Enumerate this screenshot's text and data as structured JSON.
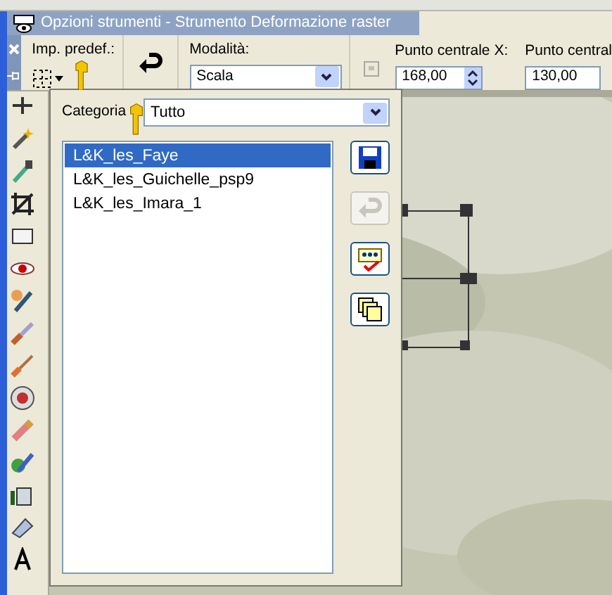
{
  "window": {
    "title": "Opzioni strumenti - Strumento Deformazione raster"
  },
  "toolbar": {
    "presets_label": "Imp. predef.:",
    "mode_label": "Modalità:",
    "mode_value": "Scala",
    "center_x_label": "Punto centrale X:",
    "center_x_value": "168,00",
    "center_y_label": "Punto central",
    "center_y_value": "130,00"
  },
  "preset_panel": {
    "category_label": "Categoria",
    "category_value": "Tutto",
    "presets": [
      {
        "name": "L&K_les_Faye",
        "selected": true
      },
      {
        "name": "L&K_les_Guichelle_psp9",
        "selected": false
      },
      {
        "name": "L&K_les_Imara_1",
        "selected": false
      }
    ],
    "buttons": [
      {
        "kind": "save",
        "disabled": false
      },
      {
        "kind": "reset",
        "disabled": true
      },
      {
        "kind": "edit",
        "disabled": false
      },
      {
        "kind": "copy",
        "disabled": false
      }
    ]
  }
}
